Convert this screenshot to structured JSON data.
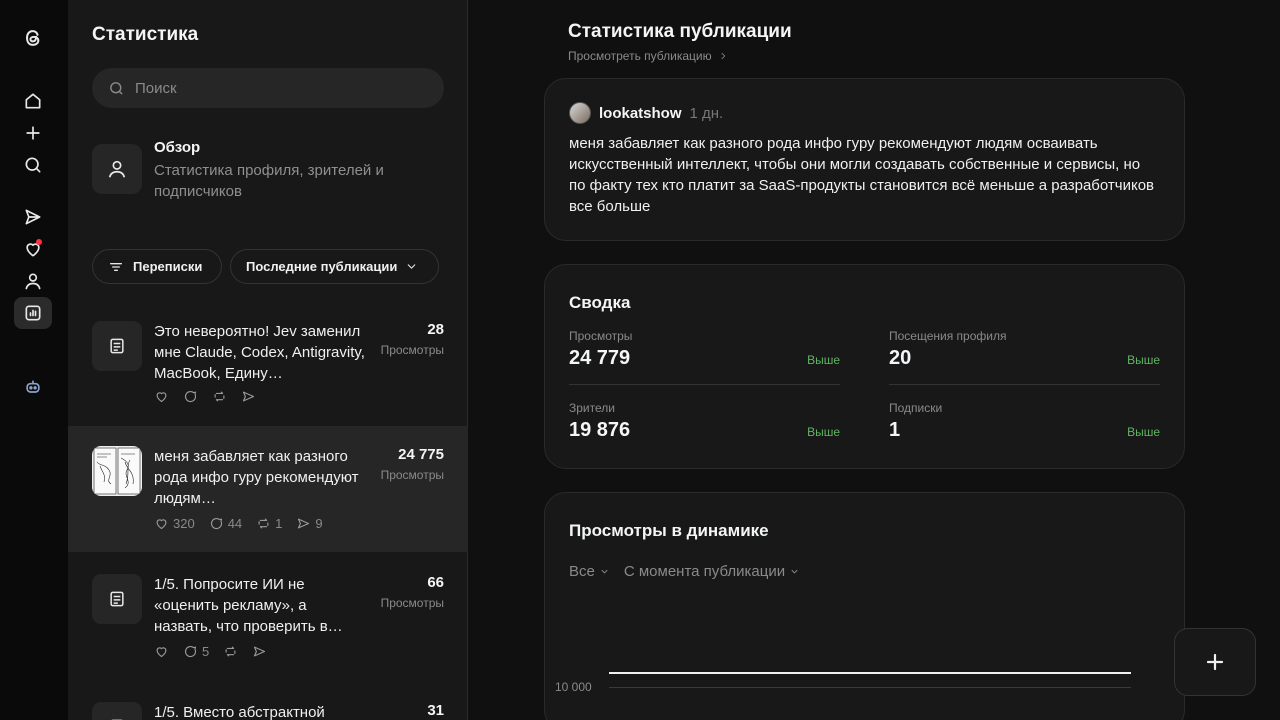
{
  "rail": {
    "icons": [
      "threads-logo-icon",
      "home-icon",
      "plus-icon",
      "search-icon",
      "send-icon",
      "heart-icon",
      "profile-icon",
      "insights-icon",
      "bot-icon"
    ]
  },
  "panel": {
    "title": "Статистика",
    "search_placeholder": "Поиск",
    "overview": {
      "title": "Обзор",
      "subtitle": "Статистика профиля, зрителей и подписчиков"
    },
    "filters": {
      "conversations": "Переписки",
      "recent": "Последние публикации"
    },
    "posts": [
      {
        "text": "Это невероятно! Jev заменил мне Claude, Codex, Antigravity, MacBook, Едину…",
        "count": "28",
        "count_label": "Просмотры",
        "likes": "",
        "replies": "",
        "reposts": "",
        "shares": ""
      },
      {
        "text": "меня забавляет как разного рода инфо гуру рекомендуют людям…",
        "count": "24 775",
        "count_label": "Просмотры",
        "likes": "320",
        "replies": "44",
        "reposts": "1",
        "shares": "9"
      },
      {
        "text": "1/5. Попросите ИИ не «оценить рекламу», а назвать, что проверить в…",
        "count": "66",
        "count_label": "Просмотры",
        "likes": "",
        "replies": "5",
        "reposts": "",
        "shares": ""
      },
      {
        "text": "1/5. Вместо абстрактной",
        "count": "31",
        "count_label": "Просмотры"
      }
    ]
  },
  "main": {
    "title": "Статистика публикации",
    "view_post": "Просмотреть публикацию",
    "post": {
      "username": "lookatshow",
      "time_ago": "1 дн.",
      "text": "меня забавляет как разного рода инфо гуру рекомендуют людям осваивать искусственный интеллект, чтобы они могли создавать собственные и сервисы, но по факту тех кто платит за SaaS-продукты становится всё меньше а разработчиков все больше"
    },
    "summary": {
      "title": "Сводка",
      "metrics": [
        {
          "label": "Просмотры",
          "value": "24 779",
          "trend": "Выше"
        },
        {
          "label": "Посещения профиля",
          "value": "20",
          "trend": "Выше"
        },
        {
          "label": "Зрители",
          "value": "19 876",
          "trend": "Выше"
        },
        {
          "label": "Подписки",
          "value": "1",
          "trend": "Выше"
        }
      ]
    },
    "dynamics": {
      "title": "Просмотры в динамике",
      "filter_all": "Все",
      "filter_period": "С момента публикации",
      "y_tick": "10 000"
    }
  },
  "colors": {
    "background": "#101010",
    "panel": "#181818",
    "selected": "#262626",
    "trend_up": "#5fb562",
    "notification_dot": "#ff3040"
  }
}
